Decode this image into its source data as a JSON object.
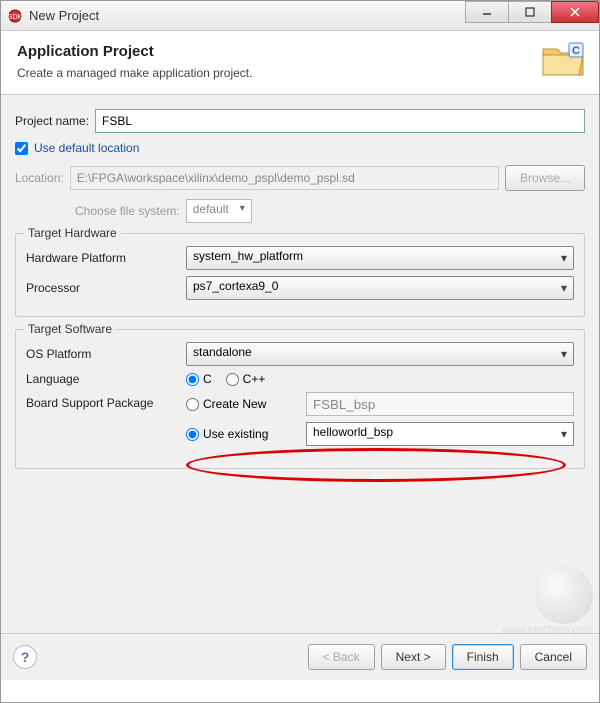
{
  "window": {
    "title": "New Project"
  },
  "banner": {
    "heading": "Application Project",
    "subheading": "Create a managed make application project."
  },
  "form": {
    "project_name_label": "Project name:",
    "project_name_value": "FSBL",
    "use_default_location_label": "Use default location",
    "use_default_location_checked": true,
    "location_label": "Location:",
    "location_value": "E:\\FPGA\\workspace\\xilinx\\demo_pspl\\demo_pspl.sd",
    "browse_label": "Browse...",
    "choose_fs_label": "Choose file system:",
    "choose_fs_value": "default"
  },
  "target_hardware": {
    "group_title": "Target Hardware",
    "hw_platform_label": "Hardware Platform",
    "hw_platform_value": "system_hw_platform",
    "processor_label": "Processor",
    "processor_value": "ps7_cortexa9_0"
  },
  "target_software": {
    "group_title": "Target Software",
    "os_platform_label": "OS Platform",
    "os_platform_value": "standalone",
    "language_label": "Language",
    "language_options": {
      "c": "C",
      "cpp": "C++"
    },
    "language_selected": "c",
    "bsp_label": "Board Support Package",
    "bsp_create_new_label": "Create New",
    "bsp_create_new_value": "FSBL_bsp",
    "bsp_use_existing_label": "Use existing",
    "bsp_use_existing_value": "helloworld_bsp",
    "bsp_selected": "use_existing"
  },
  "footer": {
    "back_label": "< Back",
    "next_label": "Next >",
    "finish_label": "Finish",
    "cancel_label": "Cancel"
  },
  "watermark": {
    "text": "www.elecfans.com"
  }
}
